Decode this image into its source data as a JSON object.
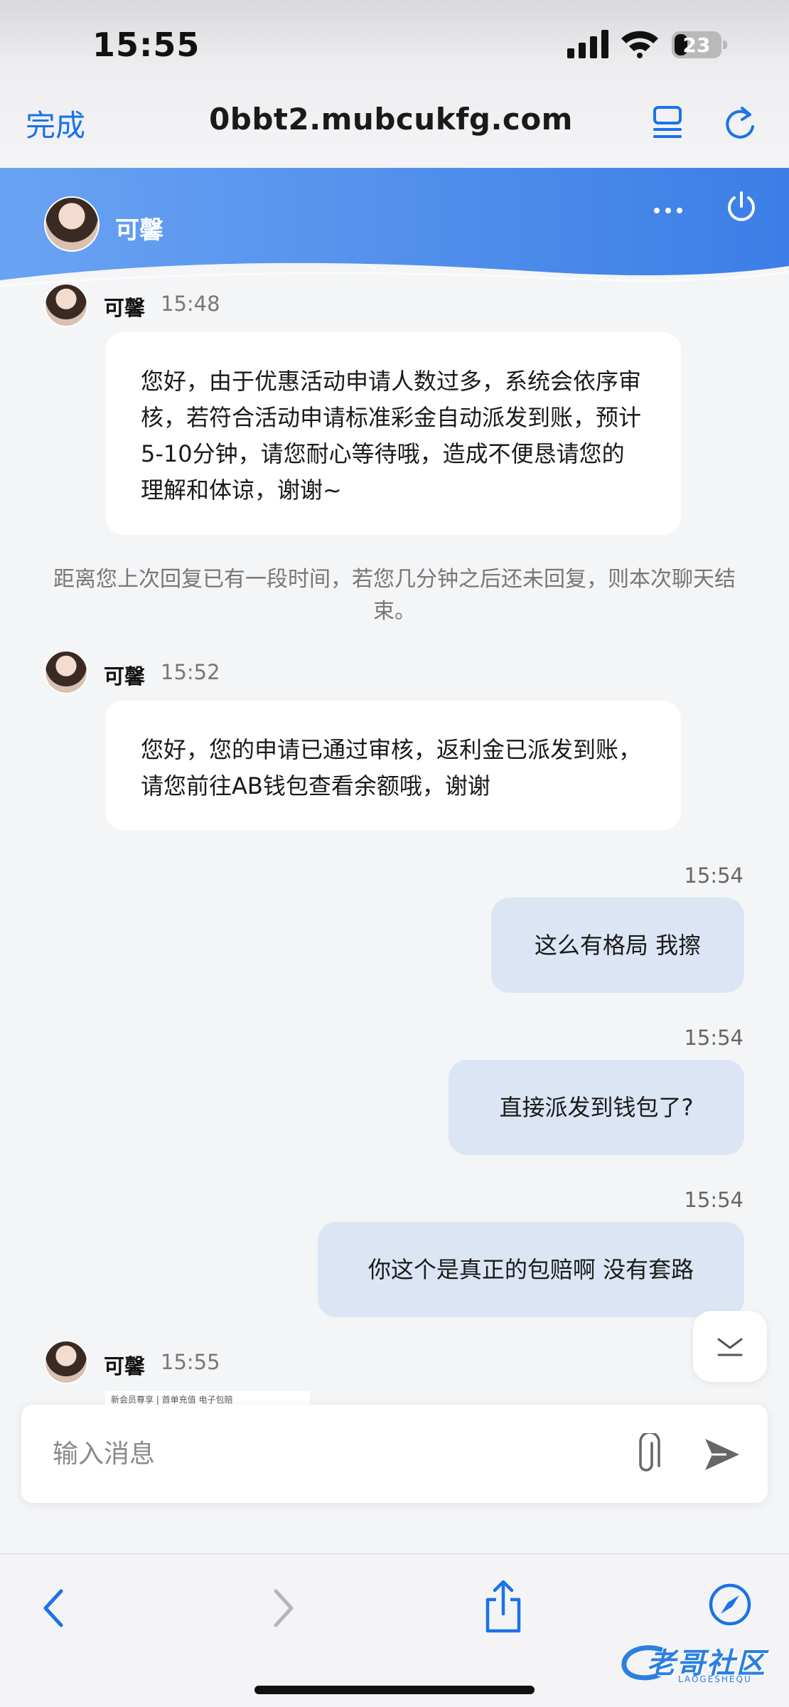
{
  "status_bar": {
    "time": "15:55",
    "battery": "23"
  },
  "browser": {
    "done_label": "完成",
    "url": "0bbt2.mubcukfg.com"
  },
  "chat_header": {
    "agent_name": "可馨"
  },
  "messages": [
    {
      "sender": "可馨",
      "time": "15:48",
      "text": "您好，由于优惠活动申请人数过多，系统会依序审核，若符合活动申请标准彩金自动派发到账，预计5-10分钟，请您耐心等待哦，造成不便恳请您的理解和体谅，谢谢~"
    },
    {
      "sender": "可馨",
      "time": "15:52",
      "text": "您好，您的申请已通过审核，返利金已派发到账，请您前往AB钱包查看余额哦，谢谢"
    },
    {
      "sender": "me",
      "time": "15:54",
      "text": "这么有格局 我擦"
    },
    {
      "sender": "me",
      "time": "15:54",
      "text": "直接派发到钱包了?"
    },
    {
      "sender": "me",
      "time": "15:54",
      "text": "你这个是真正的包赔啊 没有套路"
    },
    {
      "sender": "可馨",
      "time": "15:55",
      "text": "新会员尊享 | 首单充值 电子包赔"
    }
  ],
  "system_notice": "距离您上次回复已有一段时间，若您几分钟之后还未回复，则本次聊天结束。",
  "input": {
    "placeholder": "输入消息"
  },
  "watermark": {
    "text": "老哥社区",
    "sub": "LAOGESHEQU"
  },
  "colors": {
    "accent": "#1a73e8",
    "header_gradient_start": "#6aa3f3",
    "header_gradient_end": "#3b7ee6",
    "outgoing_bubble": "#dce5f4"
  }
}
